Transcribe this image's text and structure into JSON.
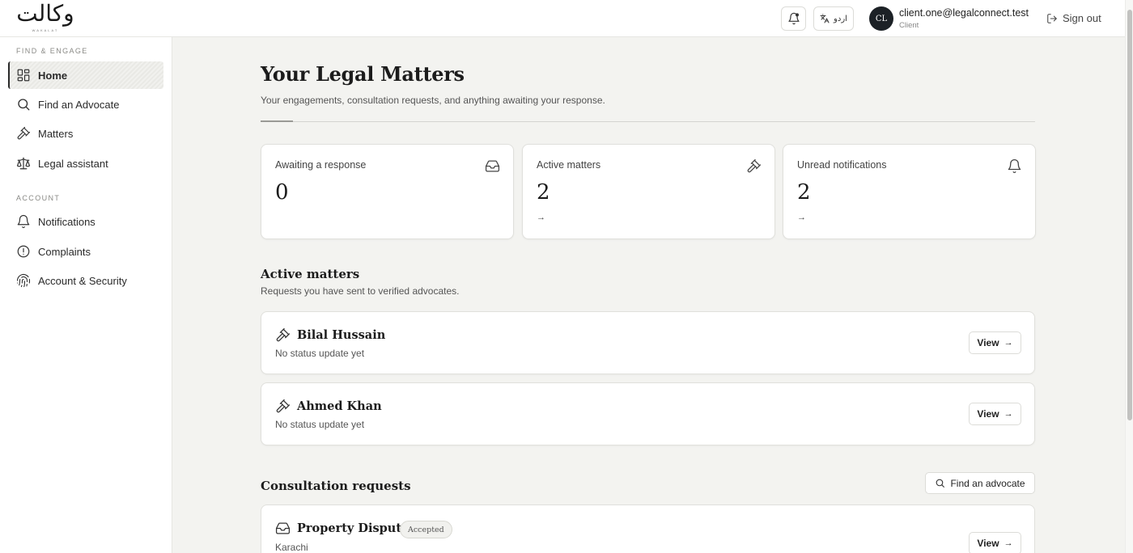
{
  "brand": {
    "logo_text": "وکالت",
    "logo_subtext": "WAKALAT"
  },
  "header": {
    "language_label": "اردو",
    "user_initials": "CL",
    "user_email": "client.one@legalconnect.test",
    "user_role": "Client",
    "signout_label": "Sign out"
  },
  "sidebar": {
    "section_find": "FIND & ENGAGE",
    "section_account": "ACCOUNT",
    "items": [
      {
        "label": "Home",
        "icon": "grid-icon"
      },
      {
        "label": "Find an Advocate",
        "icon": "search-icon"
      },
      {
        "label": "Matters",
        "icon": "gavel-icon"
      },
      {
        "label": "Legal assistant",
        "icon": "scales-icon"
      },
      {
        "label": "Notifications",
        "icon": "bell-icon"
      },
      {
        "label": "Complaints",
        "icon": "alert-circle-icon"
      },
      {
        "label": "Account & Security",
        "icon": "fingerprint-icon"
      }
    ]
  },
  "page": {
    "title": "Your Legal Matters",
    "subtitle": "Your engagements, consultation requests, and anything awaiting your response."
  },
  "stats": [
    {
      "label": "Awaiting a response",
      "value": "0",
      "icon": "inbox-icon",
      "arrow": ""
    },
    {
      "label": "Active matters",
      "value": "2",
      "icon": "gavel-icon",
      "arrow": "→"
    },
    {
      "label": "Unread notifications",
      "value": "2",
      "icon": "bell-icon",
      "arrow": "→"
    }
  ],
  "active_matters": {
    "title": "Active matters",
    "subtitle": "Requests you have sent to verified advocates.",
    "items": [
      {
        "name": "Bilal Hussain",
        "status": "No status update yet",
        "view_label": "View",
        "arrow": "→"
      },
      {
        "name": "Ahmed Khan",
        "status": "No status update yet",
        "view_label": "View",
        "arrow": "→"
      }
    ]
  },
  "consultations": {
    "title": "Consultation requests",
    "find_label": "Find an advocate",
    "items": [
      {
        "name": "Property Dispute",
        "badge": "Accepted",
        "city": "Karachi",
        "view_label": "View",
        "arrow": "→"
      }
    ]
  },
  "colors": {
    "accent_dark": "#1c2126",
    "background": "#f3f3f0",
    "card": "#ffffff"
  }
}
